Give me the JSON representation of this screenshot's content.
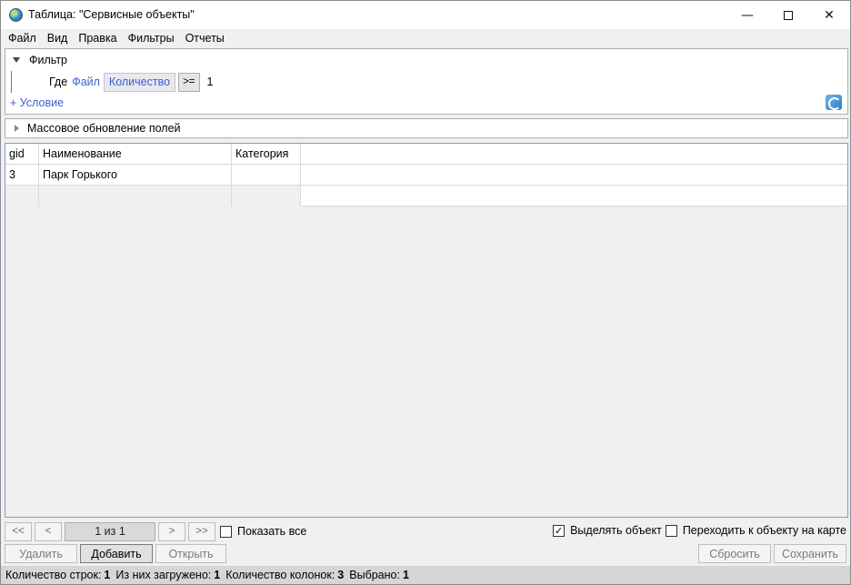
{
  "window": {
    "title": "Таблица: \"Сервисные объекты\"",
    "minimize_glyph": "—",
    "close_glyph": "✕"
  },
  "menu": {
    "items": [
      "Файл",
      "Вид",
      "Правка",
      "Фильтры",
      "Отчеты"
    ]
  },
  "filter": {
    "title": "Фильтр",
    "where_label": "Где",
    "field_source": "Файл",
    "field_name": "Количество",
    "operator": ">=",
    "value": "1",
    "add_condition": "+  Условие"
  },
  "mass_update": {
    "title": "Массовое обновление полей"
  },
  "table": {
    "columns": [
      "gid",
      "Наименование",
      "Категория",
      ""
    ],
    "rows": [
      [
        "3",
        "Парк Горького",
        "",
        ""
      ]
    ]
  },
  "pager": {
    "first_label": "<<",
    "prev_label": "<",
    "page_label": "1 из 1",
    "next_label": ">",
    "last_label": ">>",
    "show_all_label": "Показать все",
    "show_all_checked": false
  },
  "options": {
    "select_object_label": "Выделять объект",
    "select_object_checked": true,
    "goto_map_label": "Переходить к объекту на карте",
    "goto_map_checked": false
  },
  "actions": {
    "delete_label": "Удалить",
    "add_label": "Добавить",
    "open_label": "Открыть",
    "reset_label": "Сбросить",
    "save_label": "Сохранить"
  },
  "status": {
    "rows_label": "Количество строк:",
    "rows_value": "1",
    "loaded_label": "Из них загружено:",
    "loaded_value": "1",
    "cols_label": "Количество колонок:",
    "cols_value": "3",
    "selected_label": "Выбрано:",
    "selected_value": "1"
  },
  "icons": {
    "app": "globe-icon",
    "refresh": "refresh-icon",
    "expand_filter": "triangle-down-icon",
    "expand_mass": "triangle-right-icon"
  }
}
